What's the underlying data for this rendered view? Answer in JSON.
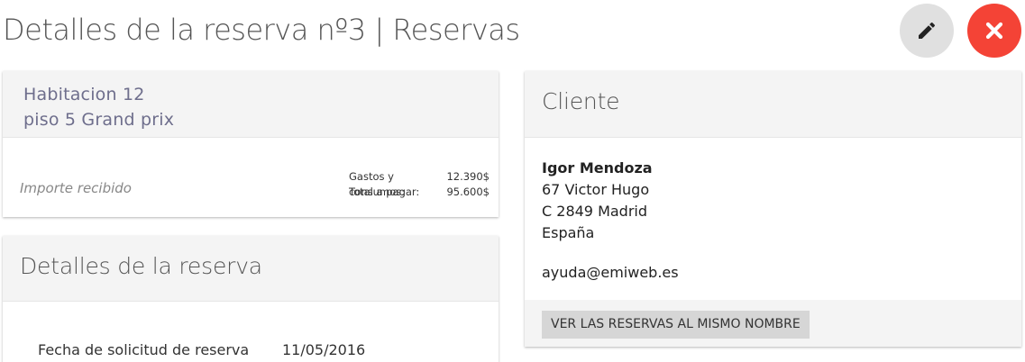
{
  "header": {
    "title": "Detalles de la reserva nº3 | Reservas",
    "edit_icon": "pencil-icon",
    "close_icon": "close-icon",
    "colors": {
      "edit_bg": "#e0e0e0",
      "close_bg": "#f44336"
    }
  },
  "room": {
    "line1": "Habitacion 12",
    "line2": "piso 5 Grand prix",
    "received_label": "Importe recibido",
    "expenses_label": "Gastos y consumos:",
    "expenses_value": "12.390$",
    "total_label": "Total a pagar:",
    "total_value": "95.600$"
  },
  "details": {
    "title": "Detalles de la reserva",
    "rows": [
      {
        "label": "Fecha de solicitud de reserva",
        "value": "11/05/2016"
      }
    ]
  },
  "client": {
    "title": "Cliente",
    "name": "Igor Mendoza",
    "address1": "67 Victor Hugo",
    "address2": "C 2849 Madrid",
    "country": "España",
    "email": "ayuda@emiweb.es",
    "button_label": "VER LAS RESERVAS AL MISMO NOMBRE"
  }
}
